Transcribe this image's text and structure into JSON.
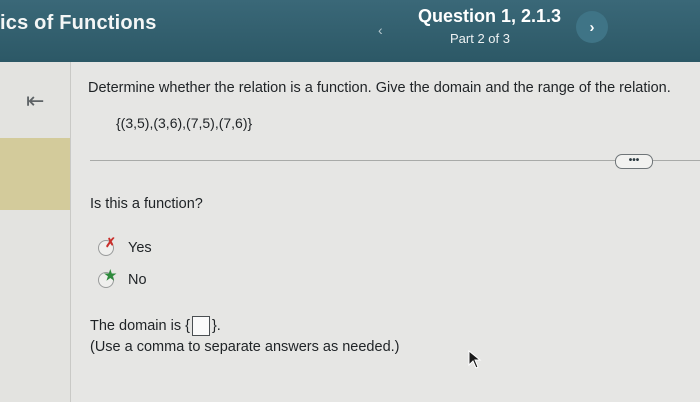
{
  "header": {
    "course_title": "ics of Functions",
    "question_title": "Question 1, 2.1.3",
    "part_label": "Part 2 of 3",
    "prev_icon": "chevron-left-icon",
    "next_icon": "chevron-right-icon"
  },
  "sidebar": {
    "collapse_icon": "collapse-left-icon"
  },
  "question": {
    "prompt": "Determine whether the relation is a function. Give the domain and the range of the relation.",
    "relation": "{(3,5),(3,6),(7,5),(7,6)}",
    "more_label": "•••",
    "sub_question": "Is this a function?",
    "options": [
      {
        "label": "Yes",
        "mark": "✗"
      },
      {
        "label": "No",
        "mark": "★"
      }
    ],
    "domain_prefix": "The domain is {",
    "domain_suffix": "}.",
    "hint": "(Use a comma to separate answers as needed.)"
  },
  "colors": {
    "header_bg": "#2f5f6e",
    "incorrect": "#c9302c",
    "correct": "#2e8a3c"
  }
}
